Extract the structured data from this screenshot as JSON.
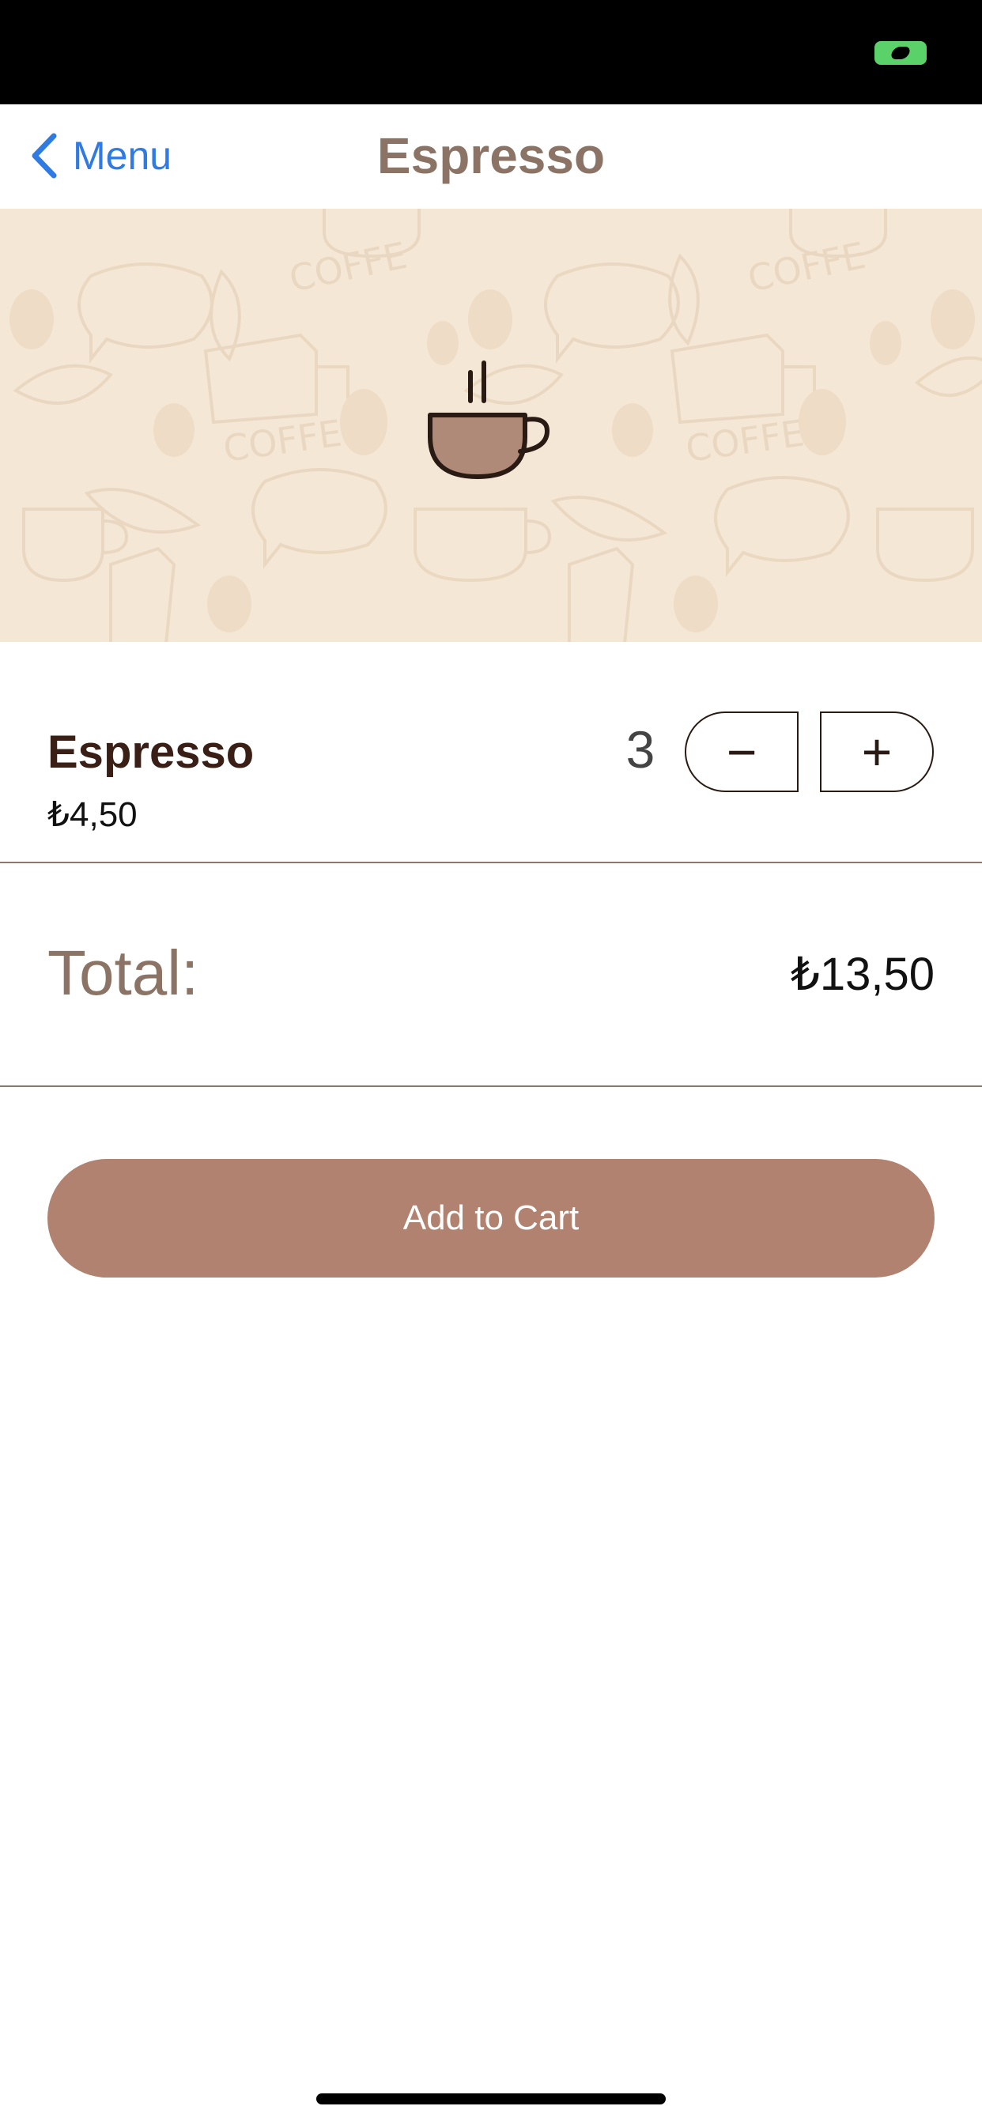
{
  "nav": {
    "back_label": "Menu",
    "title": "Espresso"
  },
  "product": {
    "name": "Espresso",
    "price": "₺4,50",
    "quantity": "3",
    "decrement_symbol": "−",
    "increment_symbol": "+"
  },
  "total": {
    "label": "Total:",
    "value": "₺13,50"
  },
  "actions": {
    "add_to_cart": "Add to Cart"
  },
  "colors": {
    "accent_link": "#2f7be3",
    "title_brown": "#8b7365",
    "dark_brown": "#3a1f16",
    "button_brown": "#b0826f",
    "hero_background": "#f5e7d6"
  },
  "icons": {
    "back": "chevron-left-icon",
    "product": "coffee-cup-icon",
    "camera_indicator": "camera-indicator-icon"
  }
}
